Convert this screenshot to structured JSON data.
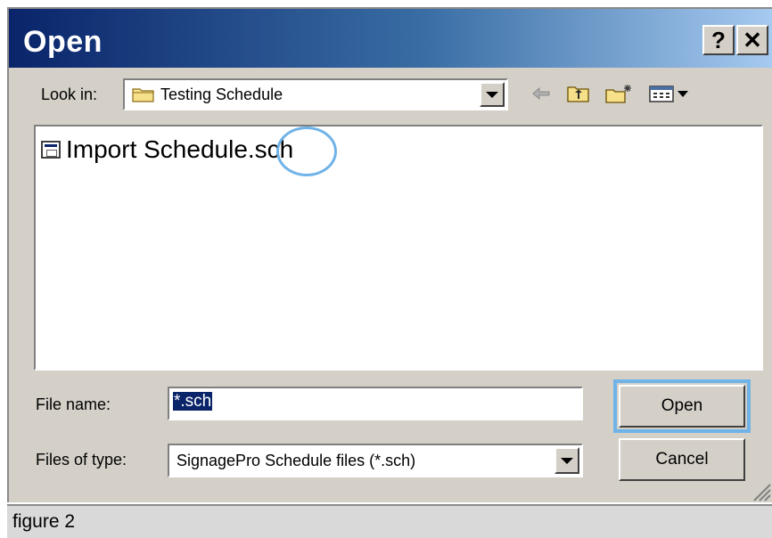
{
  "window": {
    "title": "Open"
  },
  "titlebar": {
    "help_label": "?",
    "close_label": "✕"
  },
  "look_in": {
    "label": "Look in:",
    "value": "Testing Schedule",
    "icon": "folder-icon"
  },
  "toolbar": {
    "icons": [
      "back-arrow-icon",
      "up-folder-icon",
      "new-folder-icon",
      "view-menu-icon"
    ]
  },
  "files": [
    {
      "name": "Import Schedule.sch",
      "icon": "schedule-file-icon"
    }
  ],
  "file_name": {
    "label": "File name:",
    "value": "*.sch"
  },
  "file_type": {
    "label": "Files of type:",
    "value": "SignagePro Schedule files (*.sch)"
  },
  "buttons": {
    "open": "Open",
    "cancel": "Cancel"
  },
  "caption": "figure 2",
  "colors": {
    "title_start": "#0a246a",
    "title_end": "#a6caf0",
    "highlight": "#6fb3e8",
    "face": "#d4d0c8"
  }
}
